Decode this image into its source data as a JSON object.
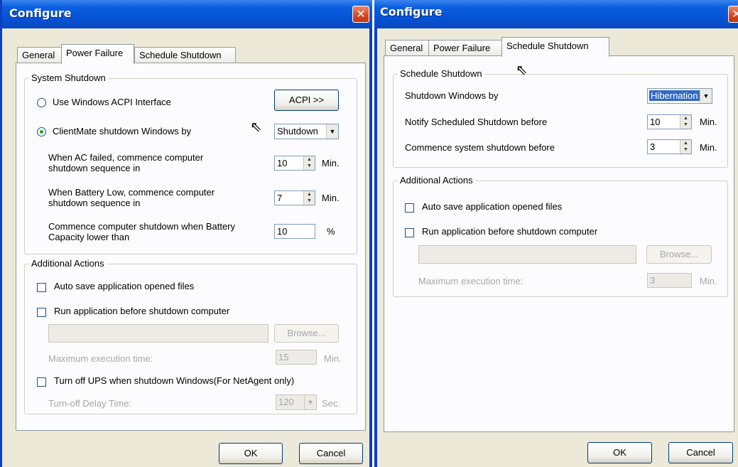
{
  "left_dialog": {
    "title": "Configure",
    "close_symbol": "✕",
    "tabs": [
      "General",
      "Power Failure",
      "Schedule Shutdown"
    ],
    "active_tab": "Power Failure",
    "system_shutdown": {
      "group_label": "System Shutdown",
      "acpi_radio_label": "Use Windows ACPI Interface",
      "acpi_button_label": "ACPI >>",
      "clientmate_radio_label": "ClientMate shutdown Windows by",
      "clientmate_select_value": "Shutdown",
      "ac_failed_label": "When AC failed, commence computer shutdown sequence in",
      "ac_failed_value": "10",
      "ac_failed_unit": "Min.",
      "battery_low_label": "When Battery Low, commence computer shutdown sequence in",
      "battery_low_value": "7",
      "battery_low_unit": "Min.",
      "capacity_label": "Commence computer shutdown when Battery Capacity lower than",
      "capacity_value": "10",
      "capacity_unit": "%"
    },
    "additional_actions": {
      "group_label": "Additional Actions",
      "auto_save_label": "Auto save application opened files",
      "run_app_label": "Run application before shutdown computer",
      "app_path_value": "",
      "browse_label": "Browse...",
      "max_exec_label": "Maximum execution time:",
      "max_exec_value": "15",
      "max_exec_unit": "Min.",
      "turn_off_ups_label": "Turn off UPS when shutdown Windows(For NetAgent only)",
      "turn_off_delay_label": "Turn-off Delay Time:",
      "turn_off_delay_value": "120",
      "turn_off_delay_unit": "Sec."
    },
    "ok_label": "OK",
    "cancel_label": "Cancel"
  },
  "right_dialog": {
    "title": "Configure",
    "close_symbol": "✕",
    "tabs": [
      "General",
      "Power Failure",
      "Schedule Shutdown"
    ],
    "active_tab": "Schedule Shutdown",
    "schedule_shutdown": {
      "group_label": "Schedule Shutdown",
      "shutdown_by_label": "Shutdown Windows by",
      "shutdown_by_value": "Hibernation",
      "notify_label": "Notify Scheduled Shutdown before",
      "notify_value": "10",
      "notify_unit": "Min.",
      "commence_label": "Commence system shutdown before",
      "commence_value": "3",
      "commence_unit": "Min."
    },
    "additional_actions": {
      "group_label": "Additional Actions",
      "auto_save_label": "Auto save application opened files",
      "run_app_label": "Run application before shutdown computer",
      "app_path_value": "",
      "browse_label": "Browse...",
      "max_exec_label": "Maximum execution time:",
      "max_exec_value": "3",
      "max_exec_unit": "Min."
    },
    "ok_label": "OK",
    "cancel_label": "Cancel"
  }
}
